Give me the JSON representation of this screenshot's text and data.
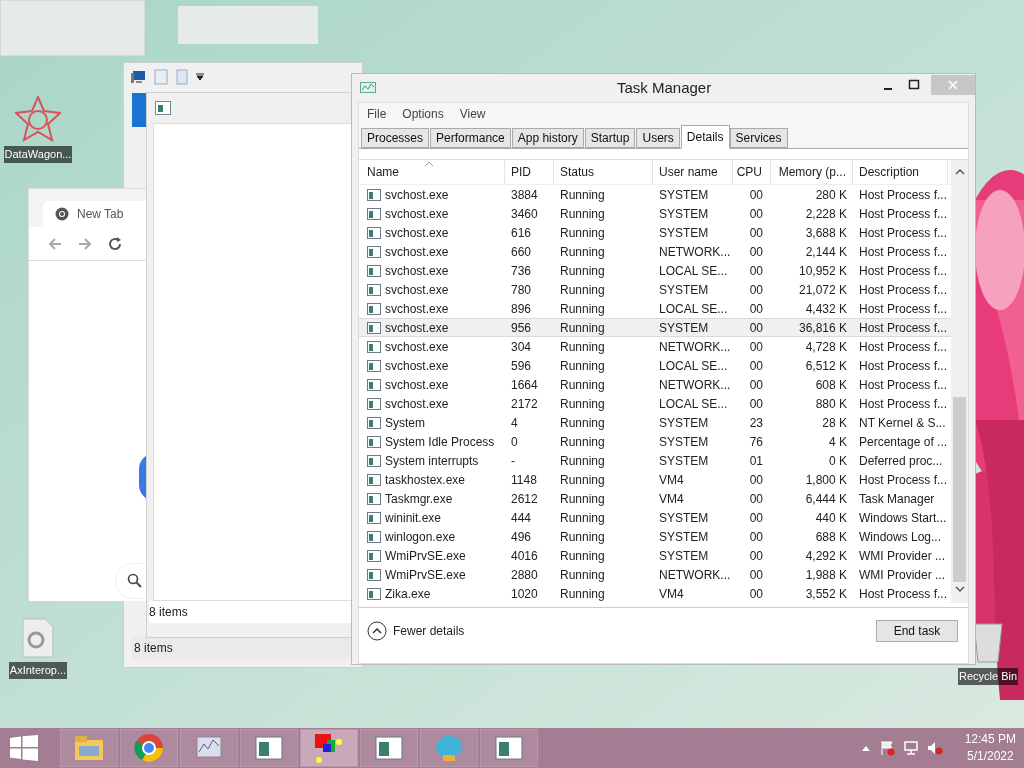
{
  "desktop_icons": [
    {
      "label": "DataWagon..."
    },
    {
      "label": "AxInterop..."
    },
    {
      "label": "Recycle Bin"
    }
  ],
  "explorer_back": {
    "status": "8 items"
  },
  "explorer_front": {
    "status": "8 items"
  },
  "browser": {
    "tab": "New Tab"
  },
  "task_manager": {
    "title": "Task Manager",
    "menu": [
      "File",
      "Options",
      "View"
    ],
    "tabs": [
      {
        "label": "Processes",
        "selected": false
      },
      {
        "label": "Performance",
        "selected": false
      },
      {
        "label": "App history",
        "selected": false
      },
      {
        "label": "Startup",
        "selected": false
      },
      {
        "label": "Users",
        "selected": false
      },
      {
        "label": "Details",
        "selected": true
      },
      {
        "label": "Services",
        "selected": false
      }
    ],
    "columns": [
      "Name",
      "PID",
      "Status",
      "User name",
      "CPU",
      "Memory (p...",
      "Description"
    ],
    "rows": [
      {
        "cells": [
          "svchost.exe",
          "3884",
          "Running",
          "SYSTEM",
          "00",
          "280 K",
          "Host Process f..."
        ],
        "selected": false
      },
      {
        "cells": [
          "svchost.exe",
          "3460",
          "Running",
          "SYSTEM",
          "00",
          "2,228 K",
          "Host Process f..."
        ],
        "selected": false
      },
      {
        "cells": [
          "svchost.exe",
          "616",
          "Running",
          "SYSTEM",
          "00",
          "3,688 K",
          "Host Process f..."
        ],
        "selected": false
      },
      {
        "cells": [
          "svchost.exe",
          "660",
          "Running",
          "NETWORK...",
          "00",
          "2,144 K",
          "Host Process f..."
        ],
        "selected": false
      },
      {
        "cells": [
          "svchost.exe",
          "736",
          "Running",
          "LOCAL SE...",
          "00",
          "10,952 K",
          "Host Process f..."
        ],
        "selected": false
      },
      {
        "cells": [
          "svchost.exe",
          "780",
          "Running",
          "SYSTEM",
          "00",
          "21,072 K",
          "Host Process f..."
        ],
        "selected": false
      },
      {
        "cells": [
          "svchost.exe",
          "896",
          "Running",
          "LOCAL SE...",
          "00",
          "4,432 K",
          "Host Process f..."
        ],
        "selected": false
      },
      {
        "cells": [
          "svchost.exe",
          "956",
          "Running",
          "SYSTEM",
          "00",
          "36,816 K",
          "Host Process f..."
        ],
        "selected": true
      },
      {
        "cells": [
          "svchost.exe",
          "304",
          "Running",
          "NETWORK...",
          "00",
          "4,728 K",
          "Host Process f..."
        ],
        "selected": false
      },
      {
        "cells": [
          "svchost.exe",
          "596",
          "Running",
          "LOCAL SE...",
          "00",
          "6,512 K",
          "Host Process f..."
        ],
        "selected": false
      },
      {
        "cells": [
          "svchost.exe",
          "1664",
          "Running",
          "NETWORK...",
          "00",
          "608 K",
          "Host Process f..."
        ],
        "selected": false
      },
      {
        "cells": [
          "svchost.exe",
          "2172",
          "Running",
          "LOCAL SE...",
          "00",
          "880 K",
          "Host Process f..."
        ],
        "selected": false
      },
      {
        "cells": [
          "System",
          "4",
          "Running",
          "SYSTEM",
          "23",
          "28 K",
          "NT Kernel & S..."
        ],
        "selected": false
      },
      {
        "cells": [
          "System Idle Process",
          "0",
          "Running",
          "SYSTEM",
          "76",
          "4 K",
          "Percentage of ..."
        ],
        "selected": false
      },
      {
        "cells": [
          "System interrupts",
          "-",
          "Running",
          "SYSTEM",
          "01",
          "0 K",
          "Deferred proc..."
        ],
        "selected": false
      },
      {
        "cells": [
          "taskhostex.exe",
          "1148",
          "Running",
          "VM4",
          "00",
          "1,800 K",
          "Host Process f..."
        ],
        "selected": false
      },
      {
        "cells": [
          "Taskmgr.exe",
          "2612",
          "Running",
          "VM4",
          "00",
          "6,444 K",
          "Task Manager"
        ],
        "selected": false
      },
      {
        "cells": [
          "wininit.exe",
          "444",
          "Running",
          "SYSTEM",
          "00",
          "440 K",
          "Windows Start..."
        ],
        "selected": false
      },
      {
        "cells": [
          "winlogon.exe",
          "496",
          "Running",
          "SYSTEM",
          "00",
          "688 K",
          "Windows Log..."
        ],
        "selected": false
      },
      {
        "cells": [
          "WmiPrvSE.exe",
          "4016",
          "Running",
          "SYSTEM",
          "00",
          "4,292 K",
          "WMI Provider ..."
        ],
        "selected": false
      },
      {
        "cells": [
          "WmiPrvSE.exe",
          "2880",
          "Running",
          "NETWORK...",
          "00",
          "1,988 K",
          "WMI Provider ..."
        ],
        "selected": false
      },
      {
        "cells": [
          "Zika.exe",
          "1020",
          "Running",
          "VM4",
          "00",
          "3,552 K",
          "Host Process f..."
        ],
        "selected": false
      }
    ],
    "fewer_details": "Fewer details",
    "end_task": "End task"
  },
  "taskbar": {
    "time": "12:45 PM",
    "date": "5/1/2022"
  }
}
